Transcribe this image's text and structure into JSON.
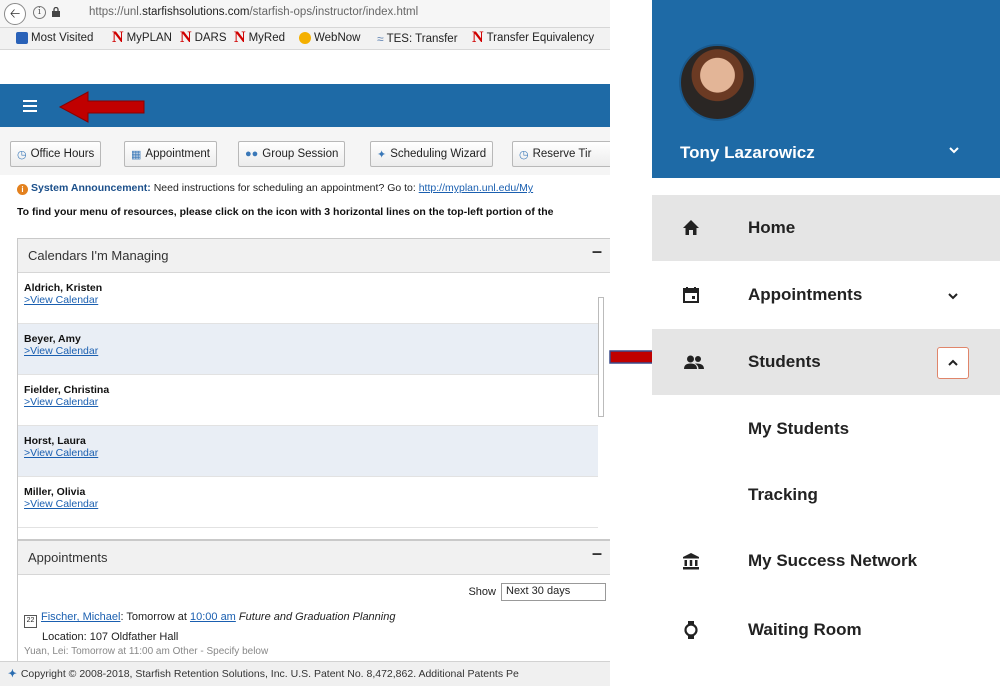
{
  "browser": {
    "url_prefix": "https://unl.",
    "url_host": "starfishsolutions.com",
    "url_path": "/starfish-ops/instructor/index.html",
    "bookmarks": [
      "Most Visited",
      "MyPLAN",
      "DARS",
      "MyRed",
      "WebNow",
      "TES: Transfer",
      "Transfer Equivalency"
    ]
  },
  "toolbar": {
    "buttons": [
      "Office Hours",
      "Appointment",
      "Group Session",
      "Scheduling Wizard",
      "Reserve Tir"
    ]
  },
  "announcement": {
    "label": "System Announcement:",
    "text": "Need instructions for scheduling an appointment? Go to:",
    "link": "http://myplan.unl.edu/My",
    "instructions": "To find your menu of resources, please click on the icon with 3 horizontal lines on the top-left portion of the"
  },
  "calendars": {
    "title": "Calendars I'm Managing",
    "link_label": ">View Calendar",
    "people": [
      "Aldrich, Kristen",
      "Beyer, Amy",
      "Fielder, Christina",
      "Horst, Laura",
      "Miller, Olivia"
    ]
  },
  "appointments": {
    "title": "Appointments",
    "show_label": "Show",
    "show_value": "Next 30 days",
    "item_date_num": "22",
    "item_name": "Fischer, Michael",
    "item_when": ": Tomorrow at ",
    "item_time": "10:00 am",
    "item_reason": "Future and Graduation Planning",
    "item_location": "Location: 107 Oldfather Hall",
    "item2_text": "Yuan, Lei: Tomorrow at 11:00 am Other - Specify below"
  },
  "footer": {
    "text": "Copyright © 2008-2018, Starfish Retention Solutions, Inc. U.S. Patent No. 8,472,862. Additional Patents Pe"
  },
  "mobile": {
    "user_name": "Tony Lazarowicz",
    "menu": [
      {
        "label": "Home",
        "icon": "home-icon"
      },
      {
        "label": "Appointments",
        "icon": "calendar-icon"
      },
      {
        "label": "Students",
        "icon": "people-icon"
      }
    ],
    "students_sub": [
      "My Students",
      "Tracking"
    ],
    "menu_more": [
      {
        "label": "My Success Network",
        "icon": "bank-icon"
      },
      {
        "label": "Waiting Room",
        "icon": "watch-icon"
      }
    ]
  },
  "colors": {
    "brand_blue": "#1e6aa6",
    "arrow_red": "#c00000",
    "active_bg": "#e5e5e5",
    "chevron_box_border": "#e0856a"
  }
}
